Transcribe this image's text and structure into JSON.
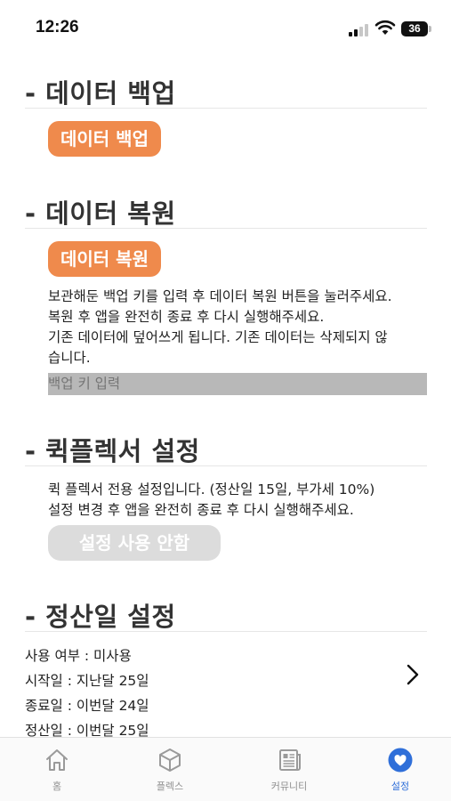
{
  "status_bar": {
    "time": "12:26",
    "battery": "36"
  },
  "backup": {
    "title": "- 데이터 백업",
    "button_label": "데이터 백업"
  },
  "restore": {
    "title": "- 데이터 복원",
    "button_label": "데이터 복원",
    "description": [
      "보관해둔 백업 키를 입력 후 데이터 복원 버튼을 눌러주세요.",
      "복원 후 앱을 완전히 종료 후 다시 실행해주세요.",
      "기존 데이터에 덮어쓰게 됩니다. 기존 데이터는 삭제되지 않",
      "습니다."
    ],
    "key_input_placeholder": "백업 키 입력"
  },
  "quickflex": {
    "title": "- 퀵플렉서 설정",
    "description": [
      "퀵 플렉서 전용 설정입니다. (정산일 15일, 부가세 10%)",
      "설정 변경 후 앱을 완전히 종료 후 다시 실행해주세요."
    ],
    "button_label": "설정 사용 안함"
  },
  "settlement": {
    "title": "- 정산일 설정",
    "lines": [
      "사용 여부 : 미사용",
      "시작일 : 지난달 25일",
      "종료일 : 이번달 24일",
      "정산일 : 이번달 25일"
    ]
  },
  "tabs": [
    {
      "label": "홈",
      "icon": "home-icon",
      "active": false
    },
    {
      "label": "플렉스",
      "icon": "box-icon",
      "active": false
    },
    {
      "label": "커뮤니티",
      "icon": "newspaper-icon",
      "active": false
    },
    {
      "label": "설정",
      "icon": "heart-icon",
      "active": true
    }
  ],
  "colors": {
    "accent_orange": "#ef8a4c",
    "disabled_gray": "#dcdcdc",
    "active_tab_blue": "#2f6fd9",
    "input_bg": "#b8b8b8"
  }
}
